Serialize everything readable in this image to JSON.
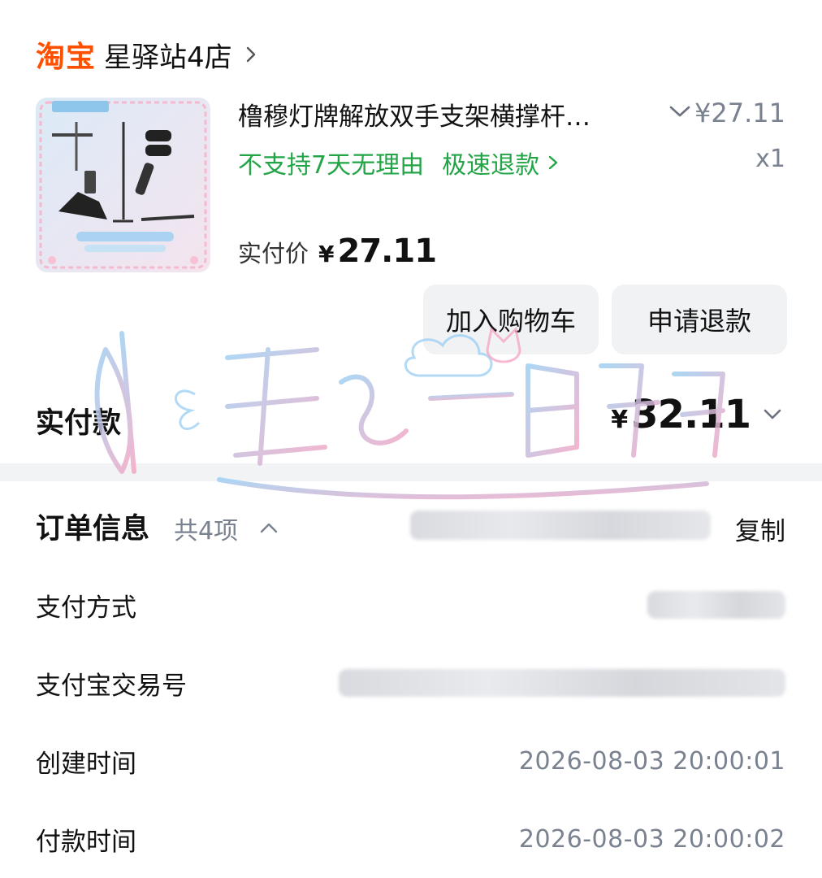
{
  "shop": {
    "logo_text": "淘宝",
    "name": "星驿站4店",
    "accent_color": "#ff5000"
  },
  "item": {
    "title": "橹穆灯牌解放双手支架横撑杆…",
    "unit_price": "¥27.11",
    "quantity": "x1",
    "tag_no_return": "不支持7天无理由",
    "tag_fast_refund": "极速退款",
    "paid_label": "实付价",
    "paid_yen": "¥",
    "paid_amount": "27.11",
    "tag_color": "#22a447"
  },
  "actions": {
    "add_to_cart": "加入购物车",
    "refund": "申请退款"
  },
  "total": {
    "label": "实付款",
    "yen": "¥",
    "amount": "32.11"
  },
  "order_info": {
    "title": "订单信息",
    "count": "共4项",
    "copy": "复制",
    "rows": [
      {
        "label": "支付方式",
        "value": ""
      },
      {
        "label": "支付宝交易号",
        "value": ""
      },
      {
        "label": "创建时间",
        "value": "2026-08-03 20:00:01"
      },
      {
        "label": "付款时间",
        "value": "2026-08-03 20:00:02"
      }
    ]
  }
}
